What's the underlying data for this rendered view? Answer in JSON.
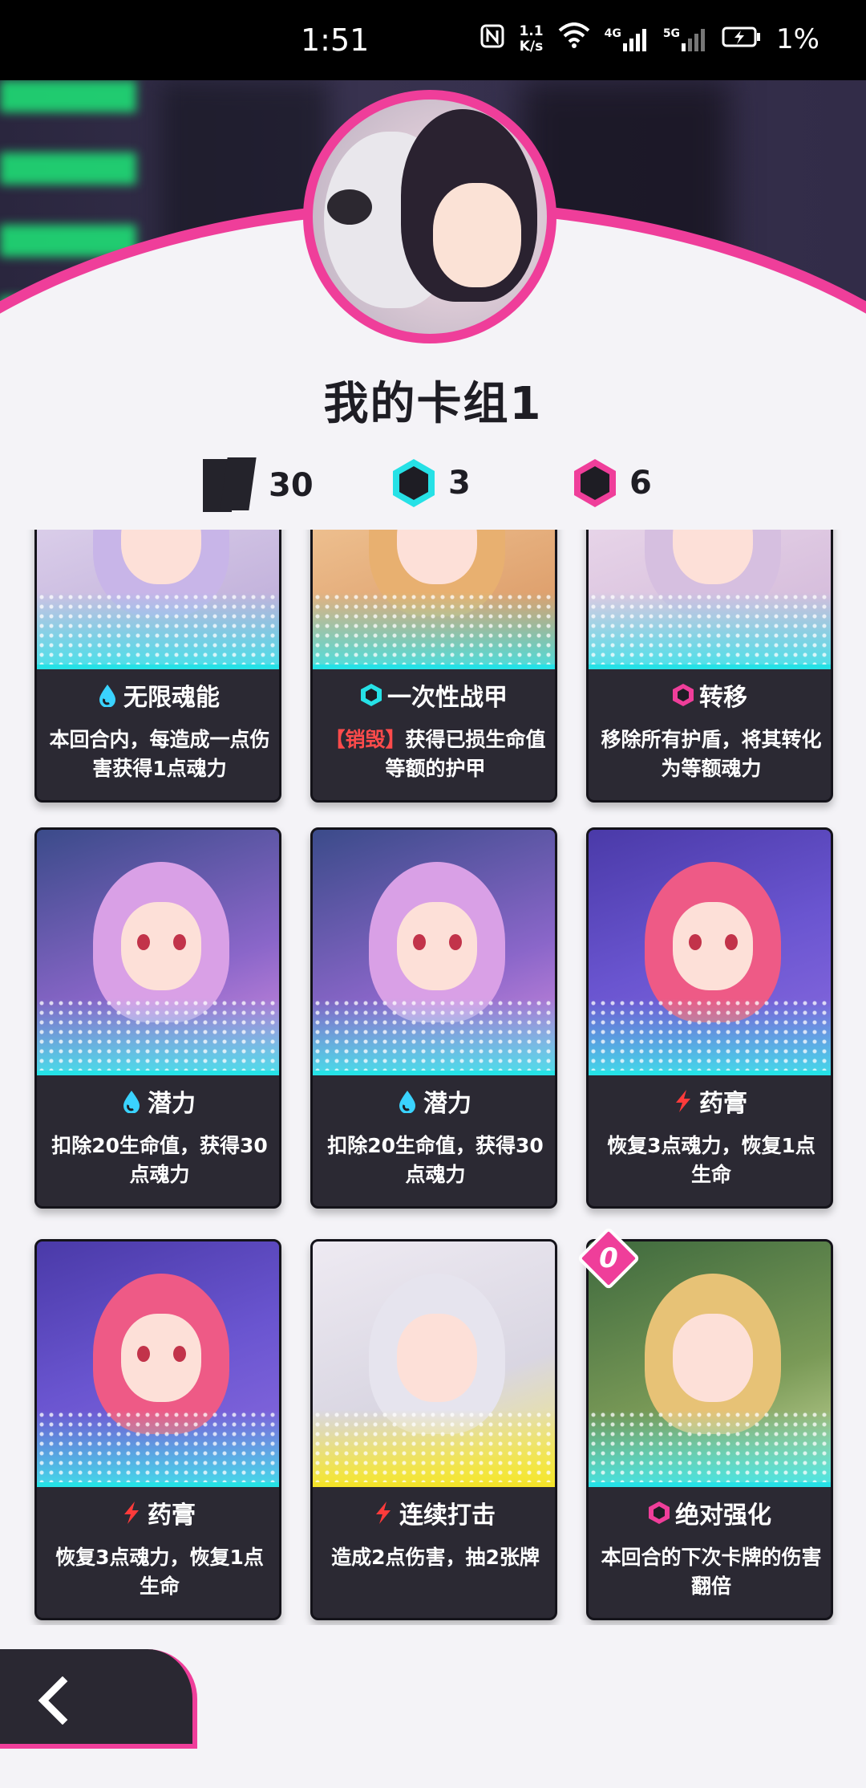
{
  "status_bar": {
    "time": "1:51",
    "net_speed_value": "1.1",
    "net_speed_unit": "K/s",
    "signal_4g": "4G",
    "signal_5g": "5G",
    "battery": "1%"
  },
  "deck": {
    "title": "我的卡组1",
    "card_count": "30",
    "cyan_count": "3",
    "pink_count": "6"
  },
  "colors": {
    "accent_pink": "#ef3e9a",
    "accent_cyan": "#26e1e6",
    "card_bg": "#2b2933",
    "keyword_red": "#ff4b4b"
  },
  "cards": [
    {
      "name": "无限魂能",
      "type_icon": "droplet-icon",
      "desc": "本回合内，每造成一点伤害获得1点魂力"
    },
    {
      "name": "一次性战甲",
      "type_icon": "cyan-hex-icon",
      "keyword": "【销毁】",
      "desc": "获得已损生命值等额的护甲"
    },
    {
      "name": "转移",
      "type_icon": "pink-hex-icon",
      "desc": "移除所有护盾，将其转化为等额魂力"
    },
    {
      "name": "潜力",
      "type_icon": "droplet-icon",
      "desc": "扣除20生命值，获得30点魂力"
    },
    {
      "name": "潜力",
      "type_icon": "droplet-icon",
      "desc": "扣除20生命值，获得30点魂力"
    },
    {
      "name": "药膏",
      "type_icon": "lightning-icon",
      "desc": "恢复3点魂力，恢复1点生命"
    },
    {
      "name": "药膏",
      "type_icon": "lightning-icon",
      "desc": "恢复3点魂力，恢复1点生命"
    },
    {
      "name": "连续打击",
      "type_icon": "lightning-icon",
      "desc": "造成2点伤害，抽2张牌"
    },
    {
      "name": "绝对强化",
      "type_icon": "pink-hex-icon",
      "cost": "0",
      "desc": "本回合的下次卡牌的伤害翻倍"
    }
  ]
}
